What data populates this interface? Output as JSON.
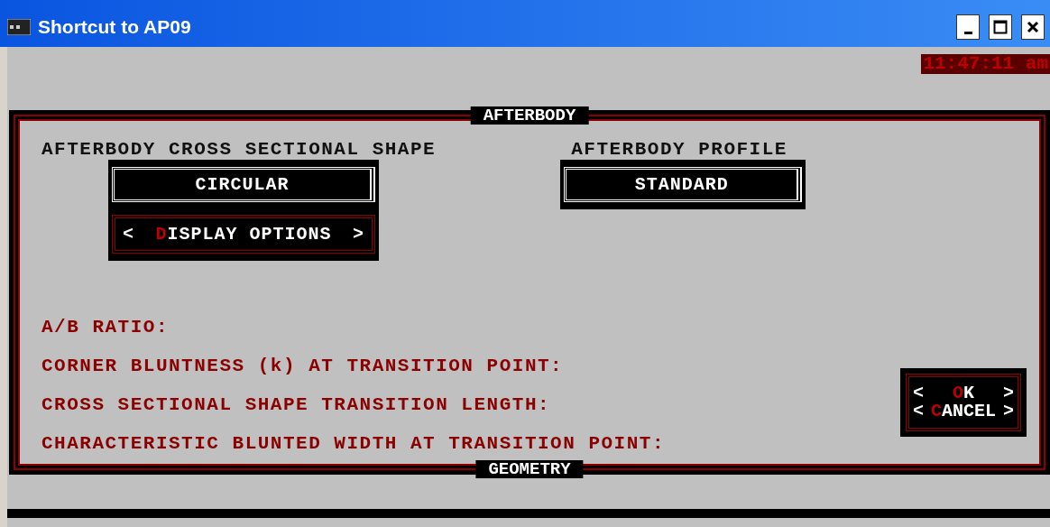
{
  "window": {
    "title": "Shortcut to AP09"
  },
  "clock": "11:47:11 am",
  "panel": {
    "title": "AFTERBODY",
    "footer": "GEOMETRY"
  },
  "shape": {
    "label": "AFTERBODY CROSS SECTIONAL SHAPE",
    "value": "CIRCULAR",
    "button": {
      "open": "<",
      "hotkey": "D",
      "rest": "ISPLAY OPTIONS",
      "close": ">"
    }
  },
  "profile": {
    "label": "AFTERBODY PROFILE",
    "value": "STANDARD"
  },
  "fields": [
    "A/B RATIO:",
    "CORNER BLUNTNESS (k) AT TRANSITION POINT:",
    "CROSS SECTIONAL SHAPE TRANSITION LENGTH:",
    "CHARACTERISTIC BLUNTED WIDTH AT TRANSITION POINT:"
  ],
  "actions": [
    {
      "open": "<",
      "hotkey": "O",
      "rest": "K",
      "close": ">"
    },
    {
      "open": "<",
      "hotkey": "C",
      "rest": "ANCEL",
      "close": ">"
    }
  ]
}
